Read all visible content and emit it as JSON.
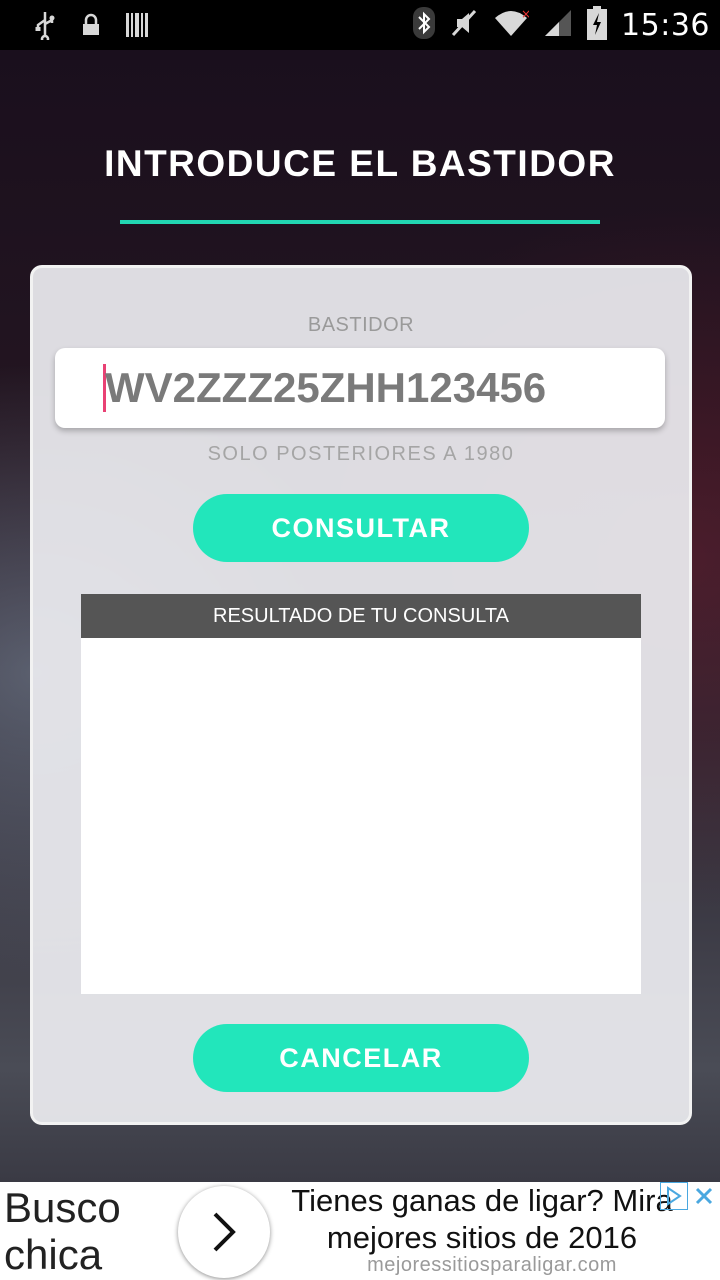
{
  "status_bar": {
    "time": "15:36",
    "icons_left": [
      "usb-icon",
      "lock-icon",
      "barcode-icon"
    ],
    "icons_right": [
      "bluetooth-icon",
      "mute-icon",
      "wifi-icon",
      "signal-icon",
      "battery-icon"
    ]
  },
  "page": {
    "title": "INTRODUCE EL BASTIDOR"
  },
  "form": {
    "field_label": "BASTIDOR",
    "vin_value": "WV2ZZZ25ZHH123456",
    "hint": "SOLO POSTERIORES A 1980",
    "consultar_label": "CONSULTAR",
    "result_header": "RESULTADO DE TU CONSULTA",
    "cancelar_label": "CANCELAR"
  },
  "ad": {
    "left_text": "Busco chica",
    "headline": "Tienes ganas de ligar? Mira mejores sitios de 2016",
    "url": "mejoressitiosparaligar.com"
  },
  "colors": {
    "accent": "#22e6bb",
    "rule": "#22d6b2",
    "cursor": "#e94174",
    "result_header_bg": "#555555"
  }
}
